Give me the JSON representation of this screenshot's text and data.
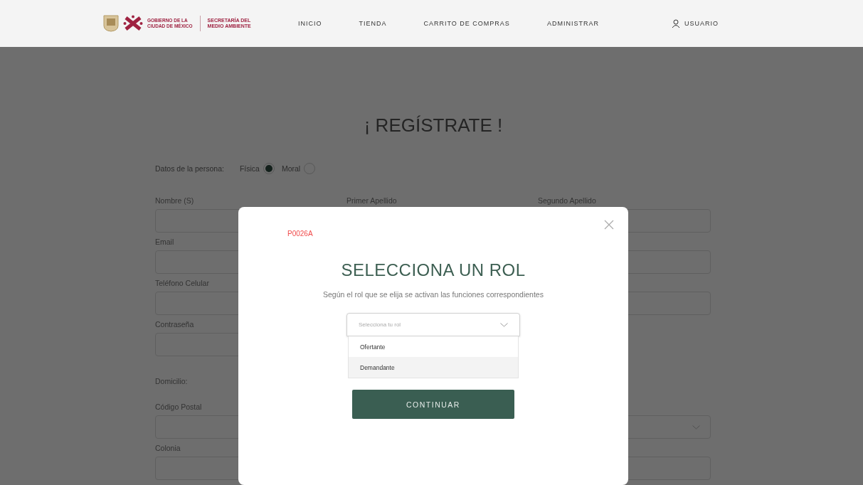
{
  "header": {
    "logo": {
      "line_1": "GOBIERNO DE LA",
      "line_2": "CIUDAD DE MÉXICO",
      "secretaria": "SECRETARÍA DEL MEDIO AMBIENTE"
    },
    "nav": [
      {
        "label": "INICIO"
      },
      {
        "label": "TIENDA"
      },
      {
        "label": "CARRITO DE COMPRAS"
      },
      {
        "label": "ADMINISTRAR"
      }
    ],
    "user": {
      "label": "USUARIO"
    }
  },
  "form": {
    "title": "¡ REGÍSTRATE !",
    "person_type": {
      "label": "Datos de la persona:",
      "options": [
        {
          "label": "Física",
          "selected": true
        },
        {
          "label": "Moral",
          "selected": false
        }
      ]
    },
    "rows": [
      {
        "kind": "fields",
        "left": {
          "kind": "text",
          "label": "Nombre (S)"
        },
        "middle": {
          "kind": "text",
          "label": "Primer Apellido"
        },
        "right": {
          "kind": "text",
          "label": "Segundo Apellido"
        }
      },
      {
        "kind": "fields",
        "left": {
          "kind": "text",
          "label": "Email"
        },
        "right": {
          "kind": "text"
        }
      },
      {
        "kind": "fields",
        "left": {
          "kind": "text",
          "label": "Teléfono Celular"
        },
        "right": {
          "kind": "text"
        }
      },
      {
        "kind": "fields",
        "left": {
          "kind": "text",
          "label": "Contraseña"
        }
      },
      {
        "kind": "heading",
        "label": "Domicilio:"
      },
      {
        "kind": "fields",
        "left": {
          "kind": "text",
          "label": "Código Postal"
        },
        "right": {
          "kind": "select"
        }
      },
      {
        "kind": "fields",
        "left": {
          "kind": "text",
          "label": "Colonia"
        },
        "right": {
          "kind": "text"
        }
      }
    ]
  },
  "modal": {
    "code": "P0026A",
    "title": "SELECCIONA UN ROL",
    "subtitle": "Según el rol que se elija se activan las funciones correspondientes",
    "select": {
      "placeholder": "Selecciona tu rol",
      "expanded": true,
      "options": [
        {
          "label": "Ofertante",
          "selected": false
        },
        {
          "label": "Demandante",
          "selected": true
        }
      ]
    },
    "button": "CONTINUAR"
  }
}
